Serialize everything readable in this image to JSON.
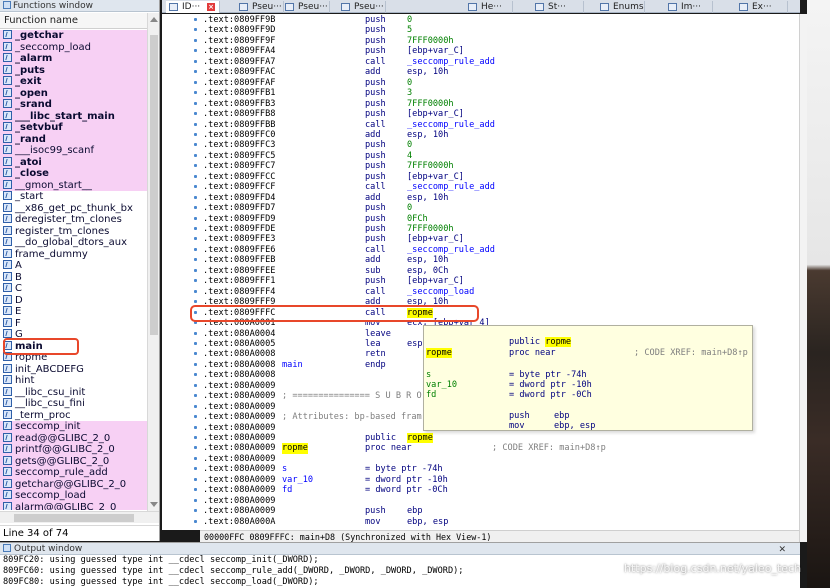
{
  "functions_window": {
    "title": "Functions window",
    "column_header": "Function name",
    "status": "Line 34 of 74",
    "items": [
      {
        "name": "_getchar",
        "lib": true,
        "bold": true
      },
      {
        "name": "_seccomp_load",
        "lib": true,
        "bold": false
      },
      {
        "name": "_alarm",
        "lib": true,
        "bold": true
      },
      {
        "name": "_puts",
        "lib": true,
        "bold": true
      },
      {
        "name": "_exit",
        "lib": true,
        "bold": true
      },
      {
        "name": "_open",
        "lib": true,
        "bold": true
      },
      {
        "name": "_srand",
        "lib": true,
        "bold": true
      },
      {
        "name": "___libc_start_main",
        "lib": true,
        "bold": true
      },
      {
        "name": "_setvbuf",
        "lib": true,
        "bold": true
      },
      {
        "name": "_rand",
        "lib": true,
        "bold": true
      },
      {
        "name": "___isoc99_scanf",
        "lib": true,
        "bold": false
      },
      {
        "name": "_atoi",
        "lib": true,
        "bold": true
      },
      {
        "name": "_close",
        "lib": true,
        "bold": true
      },
      {
        "name": "__gmon_start__",
        "lib": true,
        "bold": false
      },
      {
        "name": "_start",
        "lib": false,
        "bold": false
      },
      {
        "name": "__x86_get_pc_thunk_bx",
        "lib": false,
        "bold": false
      },
      {
        "name": "deregister_tm_clones",
        "lib": false,
        "bold": false
      },
      {
        "name": "register_tm_clones",
        "lib": false,
        "bold": false
      },
      {
        "name": "__do_global_dtors_aux",
        "lib": false,
        "bold": false
      },
      {
        "name": "frame_dummy",
        "lib": false,
        "bold": false
      },
      {
        "name": "A",
        "lib": false,
        "bold": false
      },
      {
        "name": "B",
        "lib": false,
        "bold": false
      },
      {
        "name": "C",
        "lib": false,
        "bold": false
      },
      {
        "name": "D",
        "lib": false,
        "bold": false
      },
      {
        "name": "E",
        "lib": false,
        "bold": false
      },
      {
        "name": "F",
        "lib": false,
        "bold": false
      },
      {
        "name": "G",
        "lib": false,
        "bold": false
      },
      {
        "name": "main",
        "lib": false,
        "bold": true,
        "current": true
      },
      {
        "name": "ropme",
        "lib": false,
        "bold": false
      },
      {
        "name": "init_ABCDEFG",
        "lib": false,
        "bold": false
      },
      {
        "name": "hint",
        "lib": false,
        "bold": false
      },
      {
        "name": "__libc_csu_init",
        "lib": false,
        "bold": false
      },
      {
        "name": "__libc_csu_fini",
        "lib": false,
        "bold": false
      },
      {
        "name": "_term_proc",
        "lib": false,
        "bold": false
      },
      {
        "name": "seccomp_init",
        "lib": true,
        "bold": false
      },
      {
        "name": "read@@GLIBC_2_0",
        "lib": true,
        "bold": false
      },
      {
        "name": "printf@@GLIBC_2_0",
        "lib": true,
        "bold": false
      },
      {
        "name": "gets@@GLIBC_2_0",
        "lib": true,
        "bold": false
      },
      {
        "name": "seccomp_rule_add",
        "lib": true,
        "bold": false
      },
      {
        "name": "getchar@@GLIBC_2_0",
        "lib": true,
        "bold": false
      },
      {
        "name": "seccomp_load",
        "lib": true,
        "bold": false
      },
      {
        "name": "alarm@@GLIBC_2_0",
        "lib": true,
        "bold": false
      }
    ]
  },
  "tabs": [
    {
      "label": "ID···",
      "active": true,
      "closable": true
    },
    {
      "label": "Pseu···",
      "active": false
    },
    {
      "label": "Pseu···",
      "active": false
    },
    {
      "label": "Pseu···",
      "active": false
    },
    {
      "label": "He···",
      "active": false
    },
    {
      "label": "St···",
      "active": false
    },
    {
      "label": "Enums",
      "active": false
    },
    {
      "label": "Im···",
      "active": false
    },
    {
      "label": "Ex···",
      "active": false
    }
  ],
  "disasm": {
    "lines": [
      {
        "addr": ".text:0809FF9B",
        "mn": "push",
        "op": "0"
      },
      {
        "addr": ".text:0809FF9D",
        "mn": "push",
        "op": "5"
      },
      {
        "addr": ".text:0809FF9F",
        "mn": "push",
        "op": "7FFF0000h"
      },
      {
        "addr": ".text:0809FFA4",
        "mn": "push",
        "op": "[ebp+var_C]",
        "opc": "navy"
      },
      {
        "addr": ".text:0809FFA7",
        "mn": "call",
        "op": "_seccomp_rule_add",
        "opc": "blue"
      },
      {
        "addr": ".text:0809FFAC",
        "mn": "add",
        "op": "esp, 10h",
        "opc": "navy"
      },
      {
        "addr": ".text:0809FFAF",
        "mn": "push",
        "op": "0"
      },
      {
        "addr": ".text:0809FFB1",
        "mn": "push",
        "op": "3"
      },
      {
        "addr": ".text:0809FFB3",
        "mn": "push",
        "op": "7FFF0000h"
      },
      {
        "addr": ".text:0809FFB8",
        "mn": "push",
        "op": "[ebp+var_C]",
        "opc": "navy"
      },
      {
        "addr": ".text:0809FFBB",
        "mn": "call",
        "op": "_seccomp_rule_add",
        "opc": "blue"
      },
      {
        "addr": ".text:0809FFC0",
        "mn": "add",
        "op": "esp, 10h",
        "opc": "navy"
      },
      {
        "addr": ".text:0809FFC3",
        "mn": "push",
        "op": "0"
      },
      {
        "addr": ".text:0809FFC5",
        "mn": "push",
        "op": "4"
      },
      {
        "addr": ".text:0809FFC7",
        "mn": "push",
        "op": "7FFF0000h"
      },
      {
        "addr": ".text:0809FFCC",
        "mn": "push",
        "op": "[ebp+var_C]",
        "opc": "navy"
      },
      {
        "addr": ".text:0809FFCF",
        "mn": "call",
        "op": "_seccomp_rule_add",
        "opc": "blue"
      },
      {
        "addr": ".text:0809FFD4",
        "mn": "add",
        "op": "esp, 10h",
        "opc": "navy"
      },
      {
        "addr": ".text:0809FFD7",
        "mn": "push",
        "op": "0"
      },
      {
        "addr": ".text:0809FFD9",
        "mn": "push",
        "op": "0FCh"
      },
      {
        "addr": ".text:0809FFDE",
        "mn": "push",
        "op": "7FFF0000h"
      },
      {
        "addr": ".text:0809FFE3",
        "mn": "push",
        "op": "[ebp+var_C]",
        "opc": "navy"
      },
      {
        "addr": ".text:0809FFE6",
        "mn": "call",
        "op": "_seccomp_rule_add",
        "opc": "blue"
      },
      {
        "addr": ".text:0809FFEB",
        "mn": "add",
        "op": "esp, 10h",
        "opc": "navy"
      },
      {
        "addr": ".text:0809FFEE",
        "mn": "sub",
        "op": "esp, 0Ch",
        "opc": "navy"
      },
      {
        "addr": ".text:0809FFF1",
        "mn": "push",
        "op": "[ebp+var_C]",
        "opc": "navy"
      },
      {
        "addr": ".text:0809FFF4",
        "mn": "call",
        "op": "_seccomp_load",
        "opc": "blue"
      },
      {
        "addr": ".text:0809FFF9",
        "mn": "add",
        "op": "esp, 10h",
        "opc": "navy"
      },
      {
        "addr": ".text:0809FFFC",
        "mn": "call",
        "op": "ropme",
        "opc": "hl"
      },
      {
        "addr": ".text:080A0001",
        "mn": "mov",
        "op": "ecx, [ebp+var_4]",
        "opc": "navy"
      },
      {
        "addr": ".text:080A0004",
        "mn": "leave",
        "op": ""
      },
      {
        "addr": ".text:080A0005",
        "mn": "lea",
        "op": "esp",
        "opc": "navy"
      },
      {
        "addr": ".text:080A0008",
        "mn": "retn",
        "op": ""
      },
      {
        "addr": ".text:080A0008",
        "lbl": "main",
        "mn": "endp",
        "op": ""
      },
      {
        "addr": ".text:080A0008",
        "mn": "",
        "op": ""
      },
      {
        "addr": ".text:080A0009",
        "mn": "",
        "op": ""
      },
      {
        "addr": ".text:080A0009",
        "cm": "; =============== S U B R O"
      },
      {
        "addr": ".text:080A0009",
        "mn": "",
        "op": ""
      },
      {
        "addr": ".text:080A0009",
        "cm": "; Attributes: bp-based fram"
      },
      {
        "addr": ".text:080A0009",
        "mn": "",
        "op": ""
      },
      {
        "addr": ".text:080A0009",
        "mn": "public",
        "op": "ropme",
        "opc": "hl"
      },
      {
        "addr": ".text:080A0009",
        "lbl": "ropme",
        "lblhl": true,
        "mn": "proc near",
        "xref": "; CODE XREF: main+D8↑p"
      },
      {
        "addr": ".text:080A0009",
        "mn": "",
        "op": ""
      },
      {
        "addr": ".text:080A0009",
        "lbl": "s",
        "mn": "= byte ptr -74h",
        "op": ""
      },
      {
        "addr": ".text:080A0009",
        "lbl": "var_10",
        "mn": "= dword ptr -10h",
        "op": ""
      },
      {
        "addr": ".text:080A0009",
        "lbl": "fd",
        "mn": "= dword ptr -0Ch",
        "op": ""
      },
      {
        "addr": ".text:080A0009",
        "mn": "",
        "op": ""
      },
      {
        "addr": ".text:080A0009",
        "mn": "push",
        "op": "ebp",
        "opc": "navy"
      },
      {
        "addr": ".text:080A000A",
        "mn": "mov",
        "op": "ebp, esp",
        "opc": "navy"
      }
    ],
    "status": "00000FFC 0809FFFC: main+D8 (Synchronized with Hex View-1)"
  },
  "hint": {
    "public_kw": "public",
    "public_name": "ropme",
    "label": "ropme",
    "proc": "proc near",
    "xref": "; CODE XREF: main+D8↑p",
    "vars": [
      {
        "name": "s",
        "decl": "= byte ptr -74h"
      },
      {
        "name": "var_10",
        "decl": "= dword ptr -10h"
      },
      {
        "name": "fd",
        "decl": "= dword ptr -0Ch"
      }
    ],
    "code": [
      {
        "mn": "push",
        "op": "ebp"
      },
      {
        "mn": "mov",
        "op": "ebp, esp"
      }
    ]
  },
  "output_window": {
    "title": "Output window",
    "lines": [
      "809FC20: using guessed type int __cdecl seccomp_init(_DWORD);",
      "809FC60: using guessed type int __cdecl seccomp_rule_add(_DWORD, _DWORD, _DWORD, _DWORD);",
      "809FC80: using guessed type int __cdecl seccomp_load(_DWORD);"
    ]
  },
  "watermark": "https://blog.csdn.net/yaleo_tech"
}
